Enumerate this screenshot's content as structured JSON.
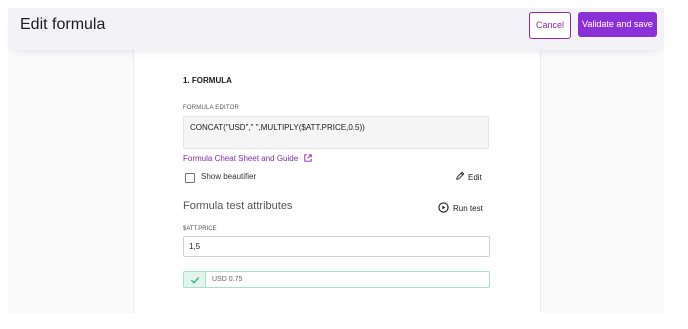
{
  "header": {
    "title": "Edit formula",
    "cancel_label": "Cancel",
    "validate_label": "Validate and save"
  },
  "colors": {
    "accent": "#8b2fd6",
    "link": "#8c2aa8",
    "success": "#2bb58a"
  },
  "formula": {
    "section_title": "1. FORMULA",
    "editor_label": "FORMULA EDITOR",
    "editor_value": "CONCAT(\"USD\",\" \",MULTIPLY($ATT.PRICE,0.5))",
    "cheat_sheet_link": "Formula Cheat Sheet and Guide",
    "show_beautifier_label": "Show beautifier",
    "show_beautifier_checked": false,
    "edit_label": "Edit"
  },
  "test": {
    "title": "Formula test attributes",
    "run_label": "Run test",
    "attribute_label": "$ATT.PRICE",
    "attribute_value": "1,5",
    "result_value": "USD 0.75"
  },
  "icons": {
    "external_link": "external-link-icon",
    "edit": "pencil-icon",
    "run": "play-circle-icon",
    "result": "check-icon"
  }
}
